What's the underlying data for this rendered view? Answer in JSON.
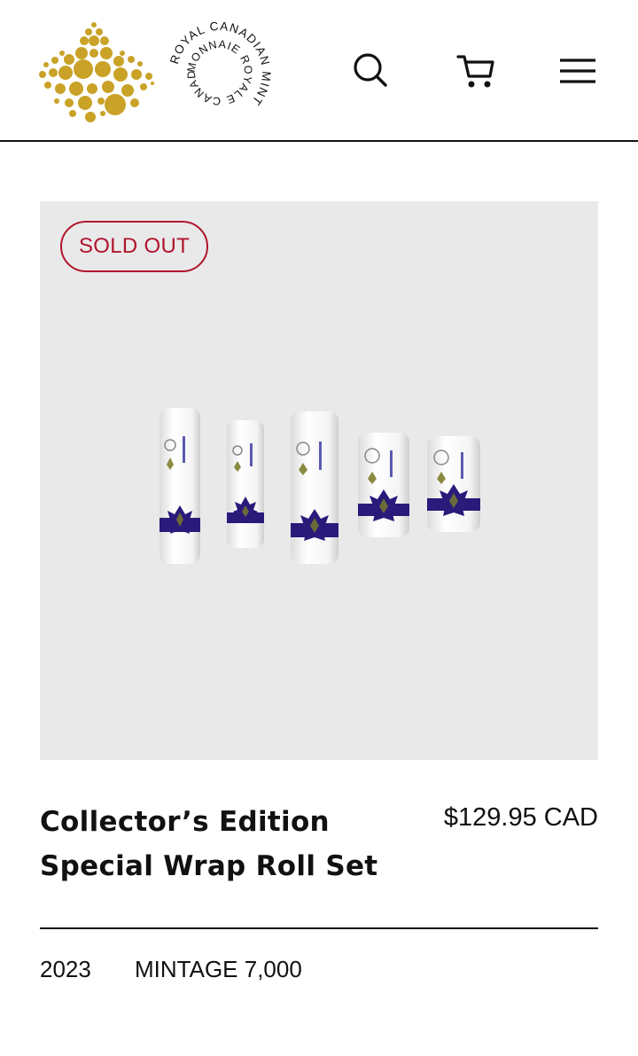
{
  "header": {
    "logo_ring_top": "ROYAL CANADIAN MINT",
    "logo_ring_bottom": "MONNAIE ROYALE CANADIENNE",
    "icons": {
      "logo": "maple-leaf-dots-icon",
      "search": "search-icon",
      "cart": "cart-icon",
      "menu": "hamburger-menu-icon"
    }
  },
  "product": {
    "badge": "SOLD OUT",
    "title_line1": "Collector’s Edition",
    "title_line2": "Special Wrap Roll Set",
    "price": "$129.95 CAD",
    "year": "2023",
    "mintage": "MINTAGE 7,000"
  },
  "colors": {
    "gold": "#c9a227",
    "sold_out_red": "#b0142e",
    "image_bg": "#e9e9e9",
    "wrap_band": "#2a1a7a"
  }
}
